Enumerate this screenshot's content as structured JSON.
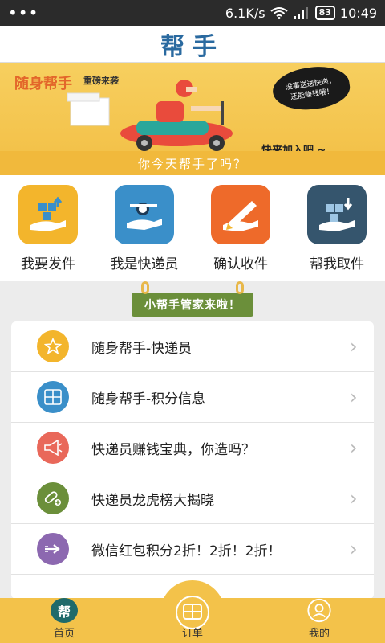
{
  "status_bar": {
    "dots": "•••",
    "net_speed": "6.1K/s",
    "battery": "83",
    "time": "10:49"
  },
  "header": {
    "title": "帮手"
  },
  "banner": {
    "slogan_main": "随身帮手",
    "slogan_sub": "重磅来袭",
    "bubble_line1": "没事送送快递，",
    "bubble_line2": "还能赚钱哦！",
    "join_text": "快来加入吧 ~",
    "tagline": "你今天帮手了吗？"
  },
  "quick_actions": [
    {
      "label": "我要发件",
      "color": "#f3b52c",
      "icon": "send-parcel-icon"
    },
    {
      "label": "我是快递员",
      "color": "#3a8fc9",
      "icon": "courier-icon"
    },
    {
      "label": "确认收件",
      "color": "#ee6a2a",
      "icon": "confirm-receipt-icon"
    },
    {
      "label": "帮我取件",
      "color": "#35556d",
      "icon": "pickup-icon"
    }
  ],
  "helper_tag": "小帮手管家来啦！",
  "list_items": [
    {
      "label": "随身帮手-快递员",
      "color": "#f3b52c",
      "icon": "star-icon"
    },
    {
      "label": "随身帮手-积分信息",
      "color": "#3a8fc9",
      "icon": "grid-icon"
    },
    {
      "label": "快递员赚钱宝典，你造吗？",
      "color": "#e9685a",
      "icon": "megaphone-icon"
    },
    {
      "label": "快递员龙虎榜大揭晓",
      "color": "#6b8f3a",
      "icon": "link-plus-icon"
    },
    {
      "label": "微信红包积分2折！2折！2折！",
      "color": "#8c68b0",
      "icon": "arrow-right-icon"
    }
  ],
  "bottom_nav": {
    "home": "首页",
    "orders": "订单",
    "mine": "我的",
    "home_badge": "帮"
  }
}
